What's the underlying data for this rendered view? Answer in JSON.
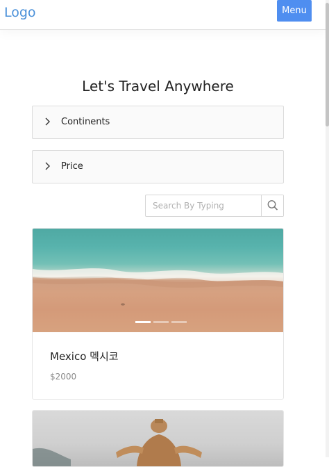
{
  "header": {
    "logo_text": "Logo",
    "menu_label": "Menu",
    "brand_color": "#4a90d9",
    "menu_color": "#4f8ef0"
  },
  "main": {
    "title": "Let's Travel Anywhere",
    "filters": [
      {
        "label": "Continents",
        "icon": "chevron-right-icon"
      },
      {
        "label": "Price",
        "icon": "chevron-right-icon"
      }
    ],
    "search": {
      "placeholder": "Search By Typing",
      "value": "",
      "icon": "search-icon"
    },
    "cards": [
      {
        "title": "Mexico 멕시코",
        "price": "$2000",
        "image": "beach-photo",
        "carousel": {
          "slides": 3,
          "active": 1
        }
      },
      {
        "image": "golden-statue-photo"
      }
    ]
  }
}
